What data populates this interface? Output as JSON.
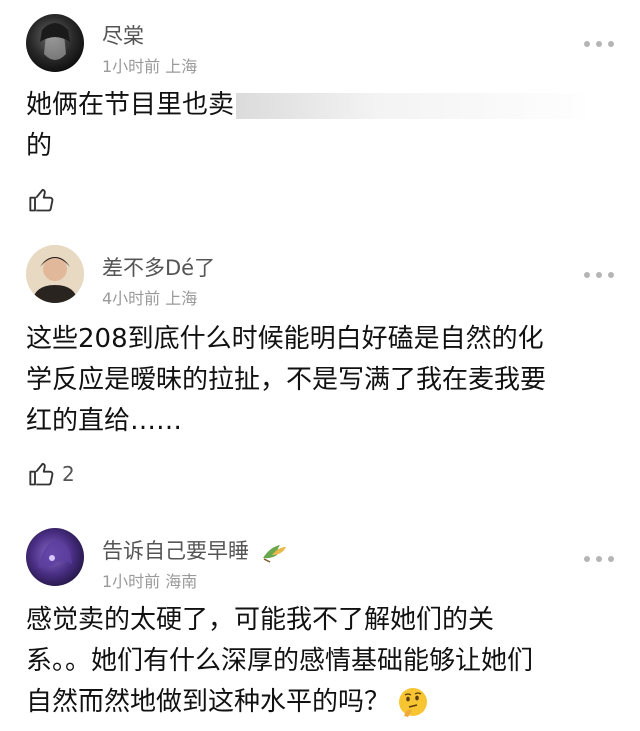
{
  "comments": [
    {
      "username": "尽棠",
      "meta": "1小时前 上海",
      "lines": [
        "她俩在节目里也卖",
        "的"
      ],
      "likes": "",
      "avatar_colors": [
        "#0b0b0b",
        "#5a5a5a"
      ]
    },
    {
      "username": "差不多Dé了",
      "meta": "4小时前 上海",
      "lines": [
        "这些208到底什么时候能明白好磕是自然的化",
        "学反应是暧昧的拉扯，不是写满了我在麦我要",
        "红的直给……"
      ],
      "likes": "2",
      "avatar_colors": [
        "#e9d4b5",
        "#3a2a22"
      ]
    },
    {
      "username": "告诉自己要早睡",
      "meta": "1小时前 海南",
      "lines": [
        "感觉卖的太硬了，可能我不了解她们的关",
        "系。。她们有什么深厚的感情基础能够让她们",
        "自然而然地做到这种水平的吗？"
      ],
      "likes": "",
      "avatar_colors": [
        "#2a1850",
        "#8a6cc8"
      ]
    }
  ],
  "icons": {
    "like": "thumbs-up-icon",
    "more": "more-dots-icon",
    "badge": "bird-badge-icon",
    "emoji": "thinking-face-emoji"
  }
}
